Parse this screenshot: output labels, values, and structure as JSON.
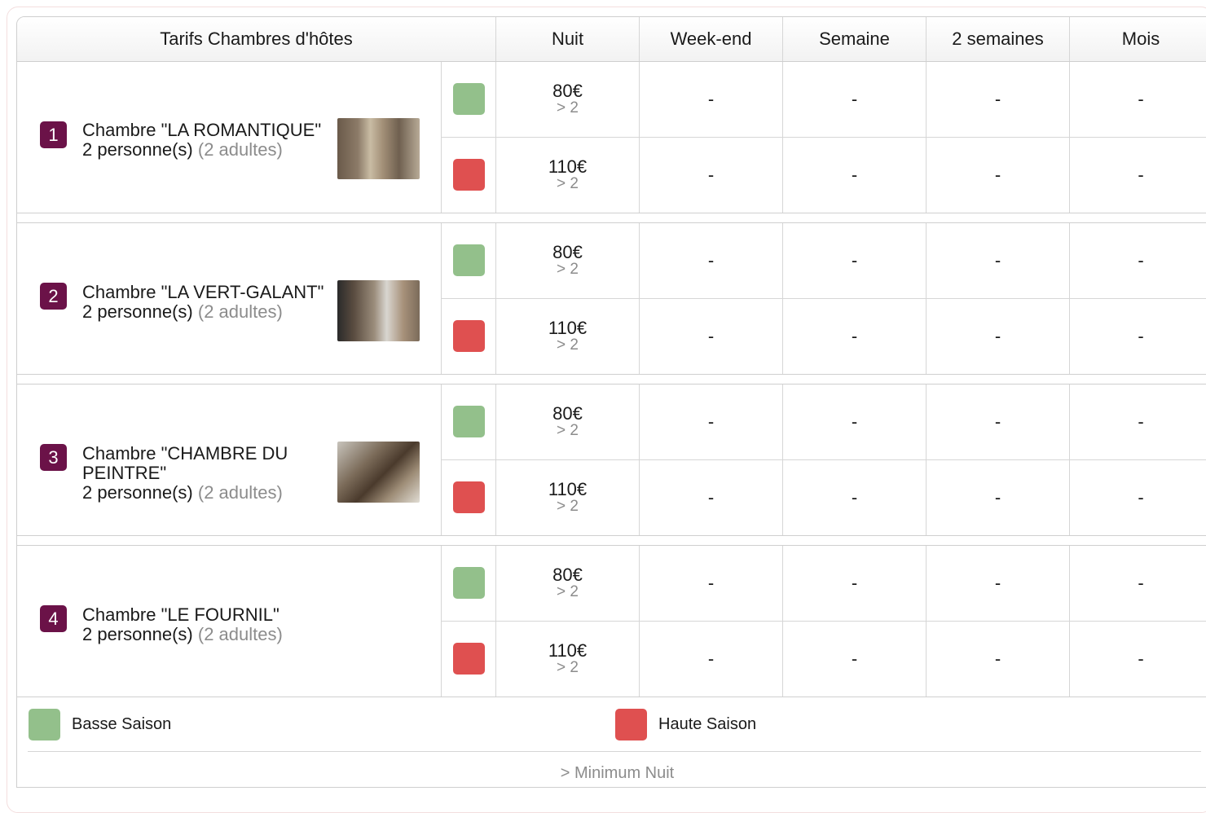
{
  "header": {
    "title": "Tarifs Chambres d'hôtes",
    "columns": [
      "Nuit",
      "Week-end",
      "Semaine",
      "2 semaines",
      "Mois"
    ]
  },
  "rooms": [
    {
      "number": "1",
      "name": "Chambre \"LA ROMANTIQUE\"",
      "capacity": "2 personne(s)",
      "adults": "(2 adultes)",
      "has_photo": true,
      "rates": [
        {
          "season": "Basse Saison",
          "color": "#93c08b",
          "nuit": "80€",
          "min": "> 2",
          "weekend": "-",
          "semaine": "-",
          "deux_semaines": "-",
          "mois": "-"
        },
        {
          "season": "Haute Saison",
          "color": "#df5050",
          "nuit": "110€",
          "min": "> 2",
          "weekend": "-",
          "semaine": "-",
          "deux_semaines": "-",
          "mois": "-"
        }
      ]
    },
    {
      "number": "2",
      "name": "Chambre \"LA VERT-GALANT\"",
      "capacity": "2 personne(s)",
      "adults": "(2 adultes)",
      "has_photo": true,
      "rates": [
        {
          "season": "Basse Saison",
          "color": "#93c08b",
          "nuit": "80€",
          "min": "> 2",
          "weekend": "-",
          "semaine": "-",
          "deux_semaines": "-",
          "mois": "-"
        },
        {
          "season": "Haute Saison",
          "color": "#df5050",
          "nuit": "110€",
          "min": "> 2",
          "weekend": "-",
          "semaine": "-",
          "deux_semaines": "-",
          "mois": "-"
        }
      ]
    },
    {
      "number": "3",
      "name": "Chambre \"CHAMBRE DU PEINTRE\"",
      "capacity": "2 personne(s)",
      "adults": "(2 adultes)",
      "has_photo": true,
      "rates": [
        {
          "season": "Basse Saison",
          "color": "#93c08b",
          "nuit": "80€",
          "min": "> 2",
          "weekend": "-",
          "semaine": "-",
          "deux_semaines": "-",
          "mois": "-"
        },
        {
          "season": "Haute Saison",
          "color": "#df5050",
          "nuit": "110€",
          "min": "> 2",
          "weekend": "-",
          "semaine": "-",
          "deux_semaines": "-",
          "mois": "-"
        }
      ]
    },
    {
      "number": "4",
      "name": "Chambre \"LE FOURNIL\"",
      "capacity": "2 personne(s)",
      "adults": "(2 adultes)",
      "has_photo": false,
      "rates": [
        {
          "season": "Basse Saison",
          "color": "#93c08b",
          "nuit": "80€",
          "min": "> 2",
          "weekend": "-",
          "semaine": "-",
          "deux_semaines": "-",
          "mois": "-"
        },
        {
          "season": "Haute Saison",
          "color": "#df5050",
          "nuit": "110€",
          "min": "> 2",
          "weekend": "-",
          "semaine": "-",
          "deux_semaines": "-",
          "mois": "-"
        }
      ]
    }
  ],
  "legend": {
    "low_label": "Basse Saison",
    "low_color": "#93c08b",
    "high_label": "Haute Saison",
    "high_color": "#df5050",
    "note": "> Minimum Nuit"
  }
}
